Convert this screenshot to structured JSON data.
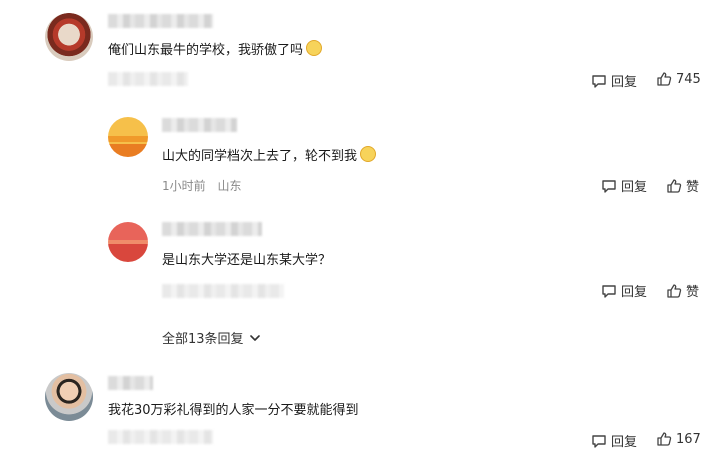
{
  "comments": [
    {
      "text": "俺们山东最牛的学校，我骄傲了吗",
      "emoji": "smiling-face-emoji",
      "reply_label": "回复",
      "like_count": "745"
    },
    {
      "text": "山大的同学档次上去了，轮不到我",
      "emoji": "laughing-face-emoji",
      "time": "1小时前",
      "location": "山东",
      "reply_label": "回复",
      "like_label": "赞"
    },
    {
      "text": "是山东大学还是山东某大学？",
      "reply_label": "回复",
      "like_label": "赞"
    },
    {
      "text": "我花30万彩礼得到的人家一分不要就能得到",
      "reply_label": "回复",
      "like_count": "167"
    }
  ],
  "expand_replies": "全部13条回复",
  "colors": {
    "text": "#1a1a1a",
    "meta": "#8a8a8a",
    "icon": "#444444"
  }
}
